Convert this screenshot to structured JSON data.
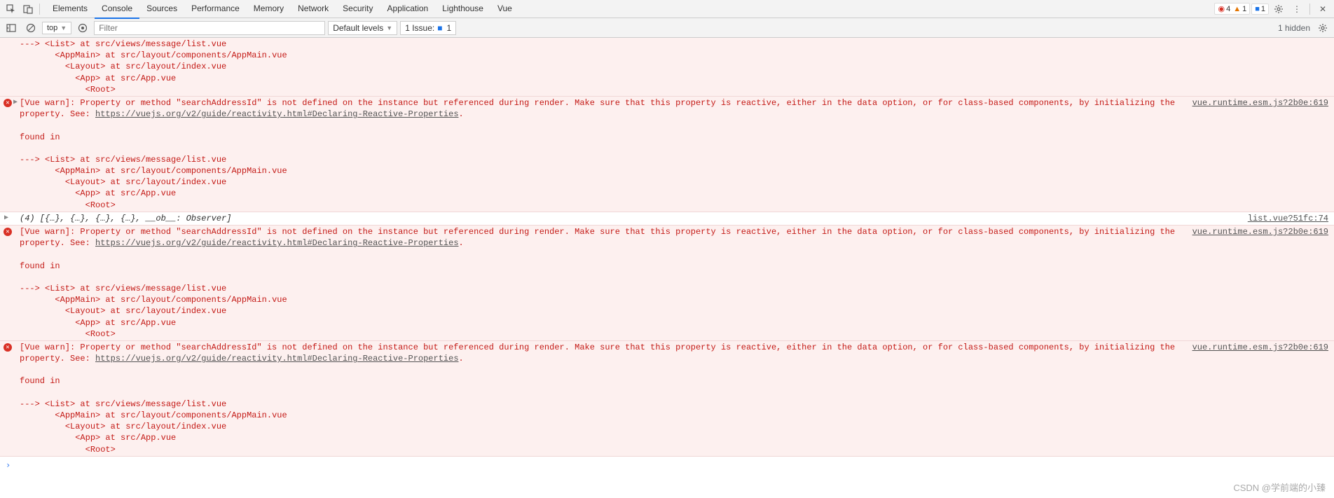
{
  "tabs": [
    "Elements",
    "Console",
    "Sources",
    "Performance",
    "Memory",
    "Network",
    "Security",
    "Application",
    "Lighthouse",
    "Vue"
  ],
  "activeTab": "Console",
  "counts": {
    "errors": "4",
    "warnings": "1",
    "issues": "1"
  },
  "filterbar": {
    "context": "top",
    "filterPlaceholder": "Filter",
    "levels": "Default levels",
    "issueLabel": "1 Issue:",
    "issueCount": "1",
    "hidden": "1 hidden"
  },
  "warnText": "[Vue warn]: Property or method \"searchAddressId\" is not defined on the instance but referenced during render. Make sure that this property is reactive, either in the data option, or for class-based components, by initializing the property. See: ",
  "warnLink": "https://vuejs.org/v2/guide/reactivity.html#Declaring-Reactive-Properties",
  "foundIn": "found in",
  "stack": "---> <List> at src/views/message/list.vue\n       <AppMain> at src/layout/components/AppMain.vue\n         <Layout> at src/layout/index.vue\n           <App> at src/App.vue\n             <Root>",
  "stackShort": "---> <List> at src/views/message/list.vue\n       <AppMain> at src/layout/components/AppMain.vue\n         <Layout> at src/layout/index.vue\n           <App> at src/App.vue\n             <Root>",
  "srcVue": "vue.runtime.esm.js?2b0e:619",
  "logLine": "(4) [{…}, {…}, {…}, {…}, __ob__: Observer]",
  "srcList": "list.vue?51fc:74",
  "watermark": "CSDN @学前端的小臻"
}
